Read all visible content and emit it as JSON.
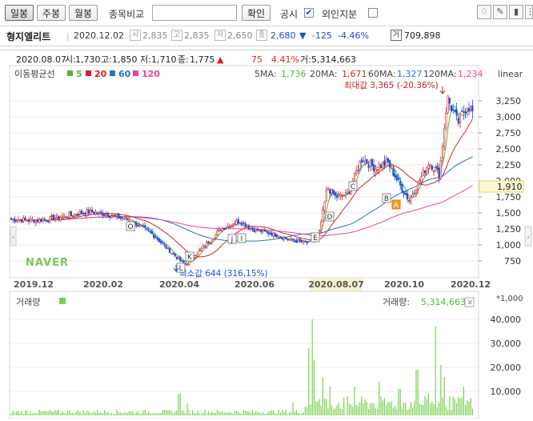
{
  "toolbar": {
    "tabs": [
      "일봉",
      "주봉",
      "월봉"
    ],
    "compare_label": "종목비교",
    "confirm_label": "확인",
    "disclosure_label": "공시",
    "disclosure_checked": true,
    "foreign_label": "외인지분",
    "foreign_checked": false
  },
  "stock": {
    "name": "형지엘리트",
    "date": "2020.12.02",
    "open_icon": "시",
    "open": "2,835",
    "high_icon": "고",
    "high": "2,835",
    "low_icon": "저",
    "low": "2,650",
    "close_icon": "종",
    "close": "2,680",
    "change_arrow": "▼",
    "change": "-125",
    "change_pct": "-4.46%",
    "volume_icon": "거",
    "volume": "709,898"
  },
  "cursor_info": {
    "date": "2020.08.07",
    "open_label": "시:",
    "open": "1,730",
    "high_label": "고:",
    "high": "1,850",
    "low_label": "저:",
    "low": "1,710",
    "close_label": "종:",
    "close": "1,775",
    "arrow": "▲",
    "change": "75",
    "change_pct": "4.41%",
    "volume_label": "거:",
    "volume": "5,314,663"
  },
  "ma_legend": {
    "title": "이동평균선",
    "items": [
      {
        "label": "5",
        "color": "#56b33a"
      },
      {
        "label": "20",
        "color": "#d9231f"
      },
      {
        "label": "60",
        "color": "#2a6fd6"
      },
      {
        "label": "120",
        "color": "#e8479b"
      }
    ],
    "values": [
      {
        "label": "5MA:",
        "value": "1,736",
        "color": "#56b33a"
      },
      {
        "label": "20MA:",
        "value": "1,671",
        "color": "#d9231f"
      },
      {
        "label": "60MA:",
        "value": "1,327",
        "color": "#2a6fd6"
      },
      {
        "label": "120MA:",
        "value": "1,234",
        "color": "#e8479b"
      }
    ],
    "scale_label": "linear"
  },
  "annotations": {
    "max_label": "최대값 3,365 (-20.36%)",
    "min_label": "최소값 644 (316,15%)",
    "current_price": "1,910",
    "watermark": "NAVER"
  },
  "signals": [
    "O",
    "L",
    "K",
    "J",
    "I",
    "E",
    "D",
    "C",
    "B",
    "A"
  ],
  "volume_panel": {
    "title": "거래량",
    "label": "거래량:",
    "value": "5,314,663",
    "unit": "*1,000",
    "ticks": [
      "40,000",
      "30,000",
      "20,000",
      "10,000"
    ]
  },
  "colors": {
    "up": "#e02020",
    "down": "#1c4fd8",
    "volume": "#7bd04f",
    "highlight": "#f6f1cf"
  },
  "chart_data": {
    "type": "candlestick",
    "x_ticks": [
      "2019.12",
      "2020.02",
      "2020.04",
      "2020.06",
      "2020.08.07",
      "2020.10",
      "2020.12"
    ],
    "y_ticks": [
      750,
      1000,
      1250,
      1500,
      1750,
      2000,
      2250,
      2500,
      2750,
      3000,
      3250
    ],
    "ylim": [
      600,
      3500
    ],
    "scale": "linear",
    "price_close": [
      {
        "x": "2019.12",
        "y": 1400
      },
      {
        "x": "2020.01",
        "y": 1430
      },
      {
        "x": "2020.02",
        "y": 1520
      },
      {
        "x": "2020.03",
        "y": 1300
      },
      {
        "x": "2020.04",
        "y": 740
      },
      {
        "x": "2020.05",
        "y": 1250
      },
      {
        "x": "2020.06",
        "y": 1160
      },
      {
        "x": "2020.07",
        "y": 1030
      },
      {
        "x": "2020.08.07",
        "y": 1775
      },
      {
        "x": "2020.09",
        "y": 2300
      },
      {
        "x": "2020.10",
        "y": 1950
      },
      {
        "x": "2020.11",
        "y": 3300
      },
      {
        "x": "2020.12",
        "y": 2680
      }
    ],
    "volume_ylim": [
      0,
      42000
    ],
    "volume_ticks": [
      10000,
      20000,
      30000,
      40000
    ]
  }
}
